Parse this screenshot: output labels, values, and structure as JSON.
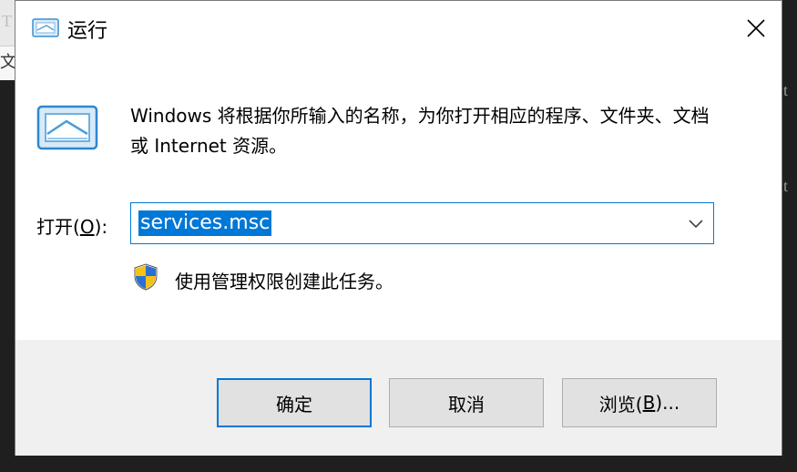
{
  "background": {
    "left_glyph_top": "T",
    "left_glyph_mid": "文",
    "right_glyph_1": "t",
    "right_glyph_2": "t"
  },
  "dialog": {
    "title": "运行",
    "description": "Windows 将根据你所输入的名称，为你打开相应的程序、文件夹、文档或 Internet 资源。",
    "open_label_prefix": "打开(",
    "open_label_accel": "O",
    "open_label_suffix": "):",
    "input_value": "services.msc",
    "admin_note": "使用管理权限创建此任务。",
    "buttons": {
      "ok": "确定",
      "cancel": "取消",
      "browse_prefix": "浏览(",
      "browse_accel": "B",
      "browse_suffix": ")..."
    }
  },
  "icons": {
    "title": "run-icon",
    "big": "run-icon",
    "close": "close-icon",
    "dropdown": "chevron-down-icon",
    "shield": "uac-shield-icon"
  },
  "colors": {
    "accent": "#0078d7",
    "footer_bg": "#f0f0f0",
    "button_bg": "#e1e1e1"
  }
}
